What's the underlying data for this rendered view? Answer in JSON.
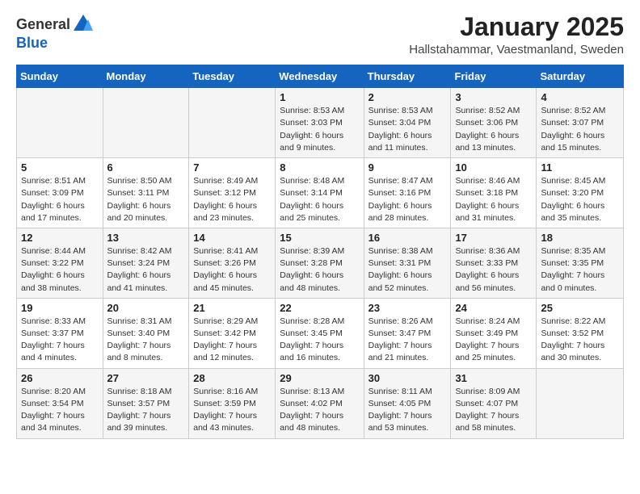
{
  "logo": {
    "general": "General",
    "blue": "Blue"
  },
  "title": "January 2025",
  "subtitle": "Hallstahammar, Vaestmanland, Sweden",
  "days_header": [
    "Sunday",
    "Monday",
    "Tuesday",
    "Wednesday",
    "Thursday",
    "Friday",
    "Saturday"
  ],
  "weeks": [
    [
      {
        "day": "",
        "info": ""
      },
      {
        "day": "",
        "info": ""
      },
      {
        "day": "",
        "info": ""
      },
      {
        "day": "1",
        "info": "Sunrise: 8:53 AM\nSunset: 3:03 PM\nDaylight: 6 hours and 9 minutes."
      },
      {
        "day": "2",
        "info": "Sunrise: 8:53 AM\nSunset: 3:04 PM\nDaylight: 6 hours and 11 minutes."
      },
      {
        "day": "3",
        "info": "Sunrise: 8:52 AM\nSunset: 3:06 PM\nDaylight: 6 hours and 13 minutes."
      },
      {
        "day": "4",
        "info": "Sunrise: 8:52 AM\nSunset: 3:07 PM\nDaylight: 6 hours and 15 minutes."
      }
    ],
    [
      {
        "day": "5",
        "info": "Sunrise: 8:51 AM\nSunset: 3:09 PM\nDaylight: 6 hours and 17 minutes."
      },
      {
        "day": "6",
        "info": "Sunrise: 8:50 AM\nSunset: 3:11 PM\nDaylight: 6 hours and 20 minutes."
      },
      {
        "day": "7",
        "info": "Sunrise: 8:49 AM\nSunset: 3:12 PM\nDaylight: 6 hours and 23 minutes."
      },
      {
        "day": "8",
        "info": "Sunrise: 8:48 AM\nSunset: 3:14 PM\nDaylight: 6 hours and 25 minutes."
      },
      {
        "day": "9",
        "info": "Sunrise: 8:47 AM\nSunset: 3:16 PM\nDaylight: 6 hours and 28 minutes."
      },
      {
        "day": "10",
        "info": "Sunrise: 8:46 AM\nSunset: 3:18 PM\nDaylight: 6 hours and 31 minutes."
      },
      {
        "day": "11",
        "info": "Sunrise: 8:45 AM\nSunset: 3:20 PM\nDaylight: 6 hours and 35 minutes."
      }
    ],
    [
      {
        "day": "12",
        "info": "Sunrise: 8:44 AM\nSunset: 3:22 PM\nDaylight: 6 hours and 38 minutes."
      },
      {
        "day": "13",
        "info": "Sunrise: 8:42 AM\nSunset: 3:24 PM\nDaylight: 6 hours and 41 minutes."
      },
      {
        "day": "14",
        "info": "Sunrise: 8:41 AM\nSunset: 3:26 PM\nDaylight: 6 hours and 45 minutes."
      },
      {
        "day": "15",
        "info": "Sunrise: 8:39 AM\nSunset: 3:28 PM\nDaylight: 6 hours and 48 minutes."
      },
      {
        "day": "16",
        "info": "Sunrise: 8:38 AM\nSunset: 3:31 PM\nDaylight: 6 hours and 52 minutes."
      },
      {
        "day": "17",
        "info": "Sunrise: 8:36 AM\nSunset: 3:33 PM\nDaylight: 6 hours and 56 minutes."
      },
      {
        "day": "18",
        "info": "Sunrise: 8:35 AM\nSunset: 3:35 PM\nDaylight: 7 hours and 0 minutes."
      }
    ],
    [
      {
        "day": "19",
        "info": "Sunrise: 8:33 AM\nSunset: 3:37 PM\nDaylight: 7 hours and 4 minutes."
      },
      {
        "day": "20",
        "info": "Sunrise: 8:31 AM\nSunset: 3:40 PM\nDaylight: 7 hours and 8 minutes."
      },
      {
        "day": "21",
        "info": "Sunrise: 8:29 AM\nSunset: 3:42 PM\nDaylight: 7 hours and 12 minutes."
      },
      {
        "day": "22",
        "info": "Sunrise: 8:28 AM\nSunset: 3:45 PM\nDaylight: 7 hours and 16 minutes."
      },
      {
        "day": "23",
        "info": "Sunrise: 8:26 AM\nSunset: 3:47 PM\nDaylight: 7 hours and 21 minutes."
      },
      {
        "day": "24",
        "info": "Sunrise: 8:24 AM\nSunset: 3:49 PM\nDaylight: 7 hours and 25 minutes."
      },
      {
        "day": "25",
        "info": "Sunrise: 8:22 AM\nSunset: 3:52 PM\nDaylight: 7 hours and 30 minutes."
      }
    ],
    [
      {
        "day": "26",
        "info": "Sunrise: 8:20 AM\nSunset: 3:54 PM\nDaylight: 7 hours and 34 minutes."
      },
      {
        "day": "27",
        "info": "Sunrise: 8:18 AM\nSunset: 3:57 PM\nDaylight: 7 hours and 39 minutes."
      },
      {
        "day": "28",
        "info": "Sunrise: 8:16 AM\nSunset: 3:59 PM\nDaylight: 7 hours and 43 minutes."
      },
      {
        "day": "29",
        "info": "Sunrise: 8:13 AM\nSunset: 4:02 PM\nDaylight: 7 hours and 48 minutes."
      },
      {
        "day": "30",
        "info": "Sunrise: 8:11 AM\nSunset: 4:05 PM\nDaylight: 7 hours and 53 minutes."
      },
      {
        "day": "31",
        "info": "Sunrise: 8:09 AM\nSunset: 4:07 PM\nDaylight: 7 hours and 58 minutes."
      },
      {
        "day": "",
        "info": ""
      }
    ]
  ]
}
